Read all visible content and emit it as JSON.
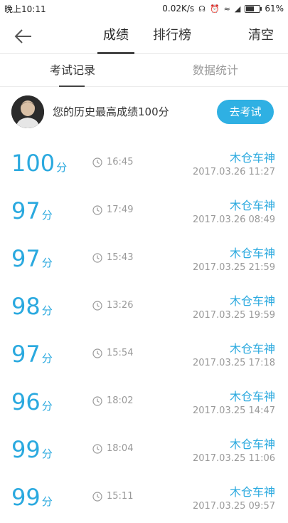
{
  "status": {
    "time": "晚上10:11",
    "speed": "0.02K/s",
    "battery": "61%",
    "battery_level": 0.61
  },
  "nav": {
    "tabs": [
      "成绩",
      "排行榜"
    ],
    "active_tab": 0,
    "clear_label": "清空"
  },
  "subtabs": {
    "items": [
      "考试记录",
      "数据统计"
    ],
    "active": 0
  },
  "best": {
    "text": "您的历史最高成绩100分",
    "button_label": "去考试"
  },
  "records": [
    {
      "score": "100",
      "unit": "分",
      "duration": "16:45",
      "car": "木仓车神",
      "date": "2017.03.26  11:27"
    },
    {
      "score": "97",
      "unit": "分",
      "duration": "17:49",
      "car": "木仓车神",
      "date": "2017.03.26  08:49"
    },
    {
      "score": "97",
      "unit": "分",
      "duration": "15:43",
      "car": "木仓车神",
      "date": "2017.03.25  21:59"
    },
    {
      "score": "98",
      "unit": "分",
      "duration": "13:26",
      "car": "木仓车神",
      "date": "2017.03.25  19:59"
    },
    {
      "score": "97",
      "unit": "分",
      "duration": "15:54",
      "car": "木仓车神",
      "date": "2017.03.25  17:18"
    },
    {
      "score": "96",
      "unit": "分",
      "duration": "18:02",
      "car": "木仓车神",
      "date": "2017.03.25  14:47"
    },
    {
      "score": "99",
      "unit": "分",
      "duration": "18:04",
      "car": "木仓车神",
      "date": "2017.03.25  11:06"
    },
    {
      "score": "99",
      "unit": "分",
      "duration": "15:11",
      "car": "木仓车神",
      "date": "2017.03.25  09:57"
    }
  ],
  "colors": {
    "accent": "#2aa9df",
    "button": "#2fb0e3"
  }
}
